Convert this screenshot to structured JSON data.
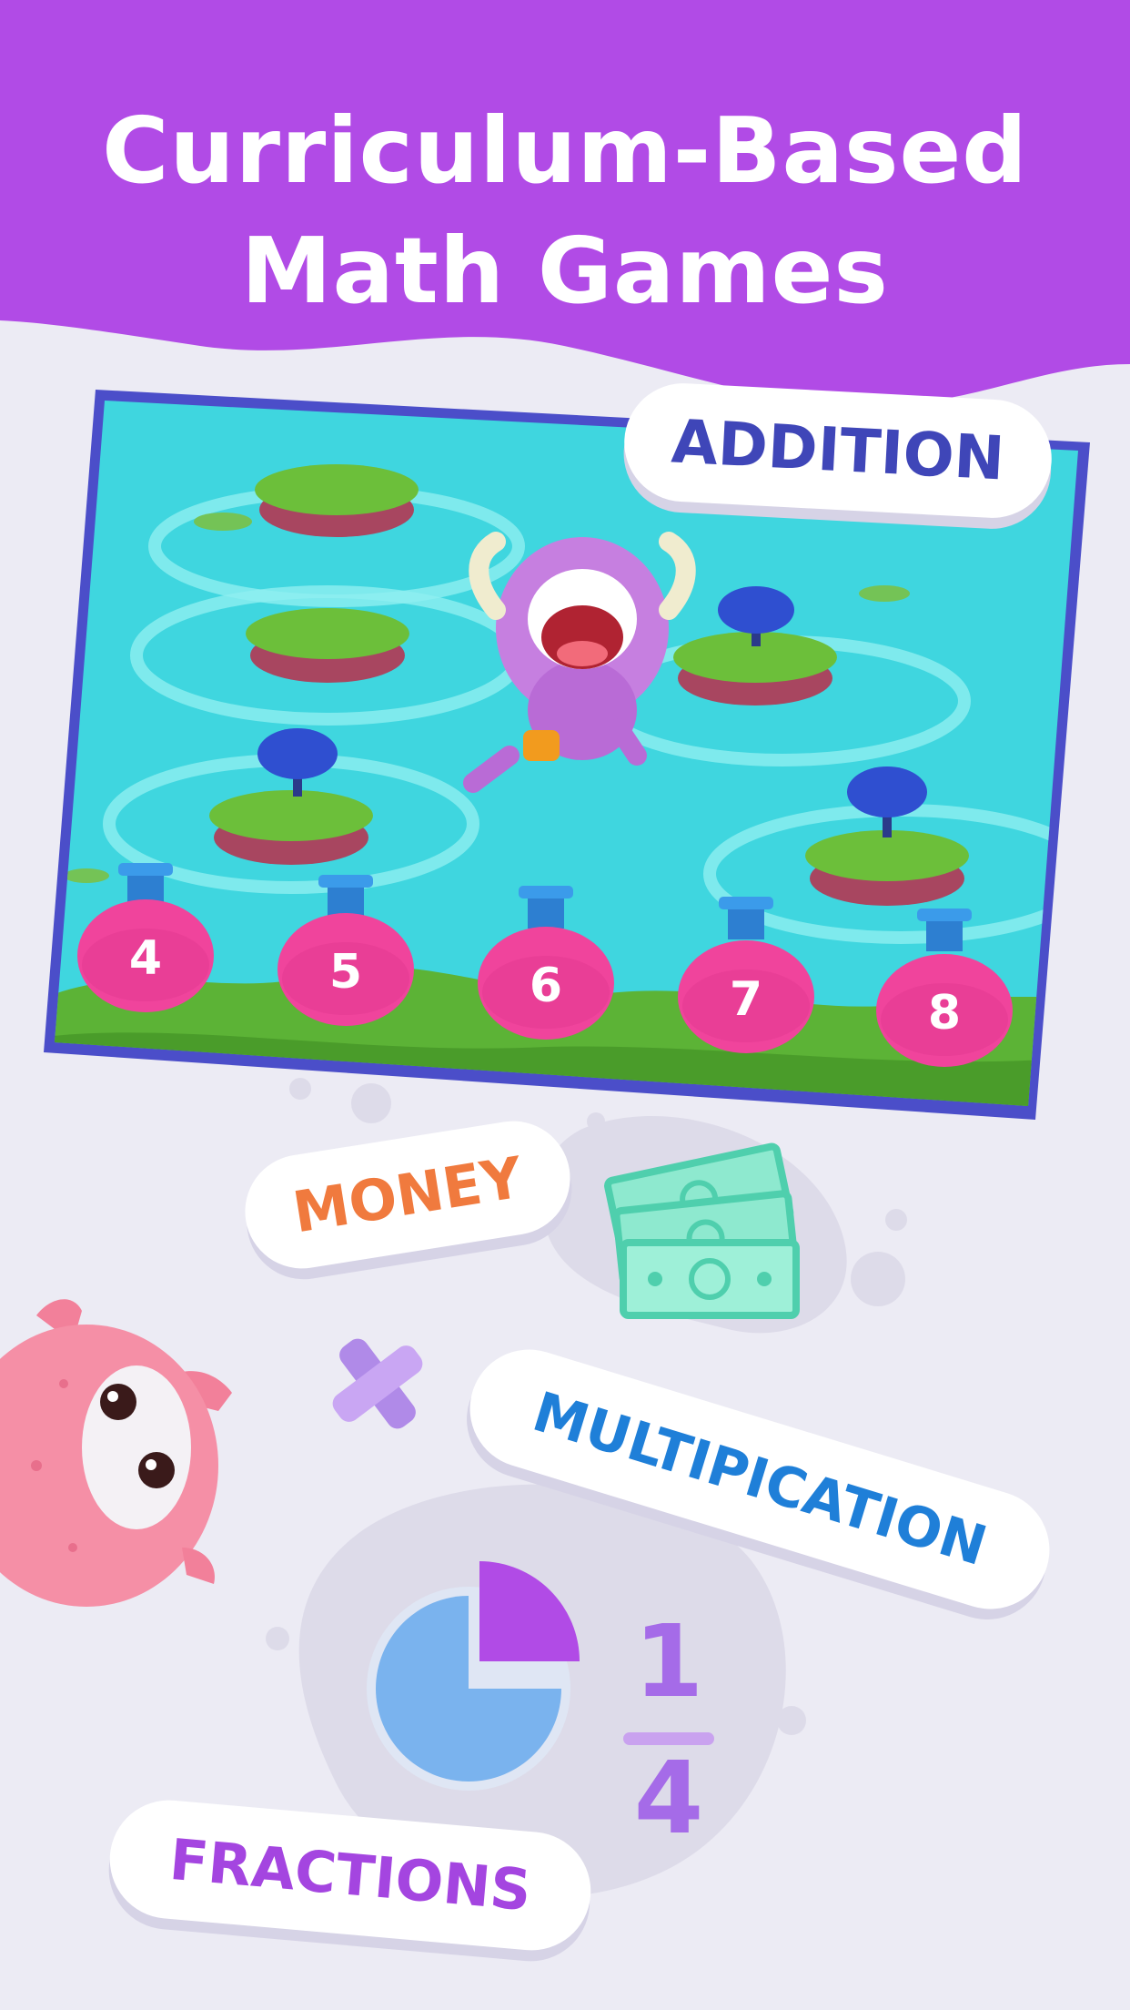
{
  "headline": {
    "line1": "Curriculum-Based",
    "line2": "Math Games"
  },
  "game_screen": {
    "topic_label": "ADDITION",
    "answer_choices": [
      "4",
      "5",
      "6",
      "7",
      "8"
    ]
  },
  "topics": {
    "money": "MONEY",
    "multiplication": "MULTIPICATION",
    "fractions": "FRACTIONS"
  },
  "fraction": {
    "numerator": "1",
    "denominator": "4"
  },
  "colors": {
    "brand_purple": "#b14be6",
    "background": "#ecebf4",
    "addition_text": "#3f46b8",
    "money_text": "#f07a3e",
    "multiplication_text": "#1f7fd8",
    "fractions_text": "#a445e0",
    "potion_pink": "#f0449c",
    "water": "#3fd6df"
  },
  "icons": [
    "monster-character",
    "money-bills-icon",
    "multiply-icon",
    "pie-chart-icon",
    "pink-monster"
  ]
}
